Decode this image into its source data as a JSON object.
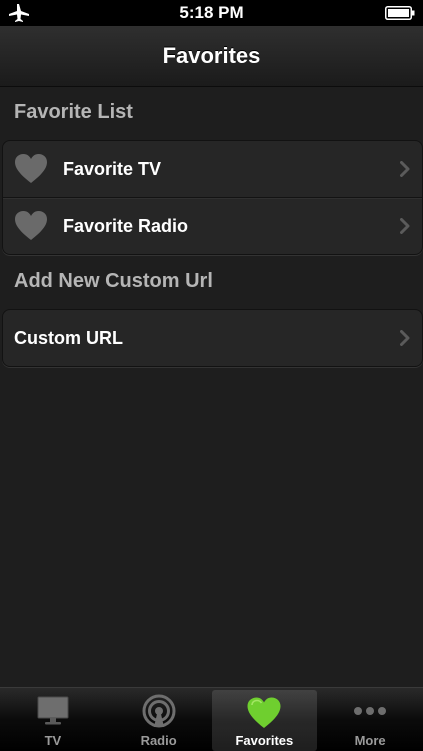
{
  "status_bar": {
    "time": "5:18 PM"
  },
  "nav": {
    "title": "Favorites"
  },
  "sections": [
    {
      "header": "Favorite List",
      "rows": [
        {
          "label": "Favorite TV",
          "icon": "heart-icon"
        },
        {
          "label": "Favorite Radio",
          "icon": "heart-icon"
        }
      ]
    },
    {
      "header": "Add New Custom Url",
      "rows": [
        {
          "label": "Custom URL"
        }
      ]
    }
  ],
  "tabs": [
    {
      "label": "TV",
      "icon": "tv-icon"
    },
    {
      "label": "Radio",
      "icon": "radio-icon"
    },
    {
      "label": "Favorites",
      "icon": "heart-icon",
      "active": true
    },
    {
      "label": "More",
      "icon": "more-icon"
    }
  ],
  "colors": {
    "accent": "#6fcf2f",
    "background": "#1e1e1e",
    "section_header": "#b5b5b5"
  }
}
